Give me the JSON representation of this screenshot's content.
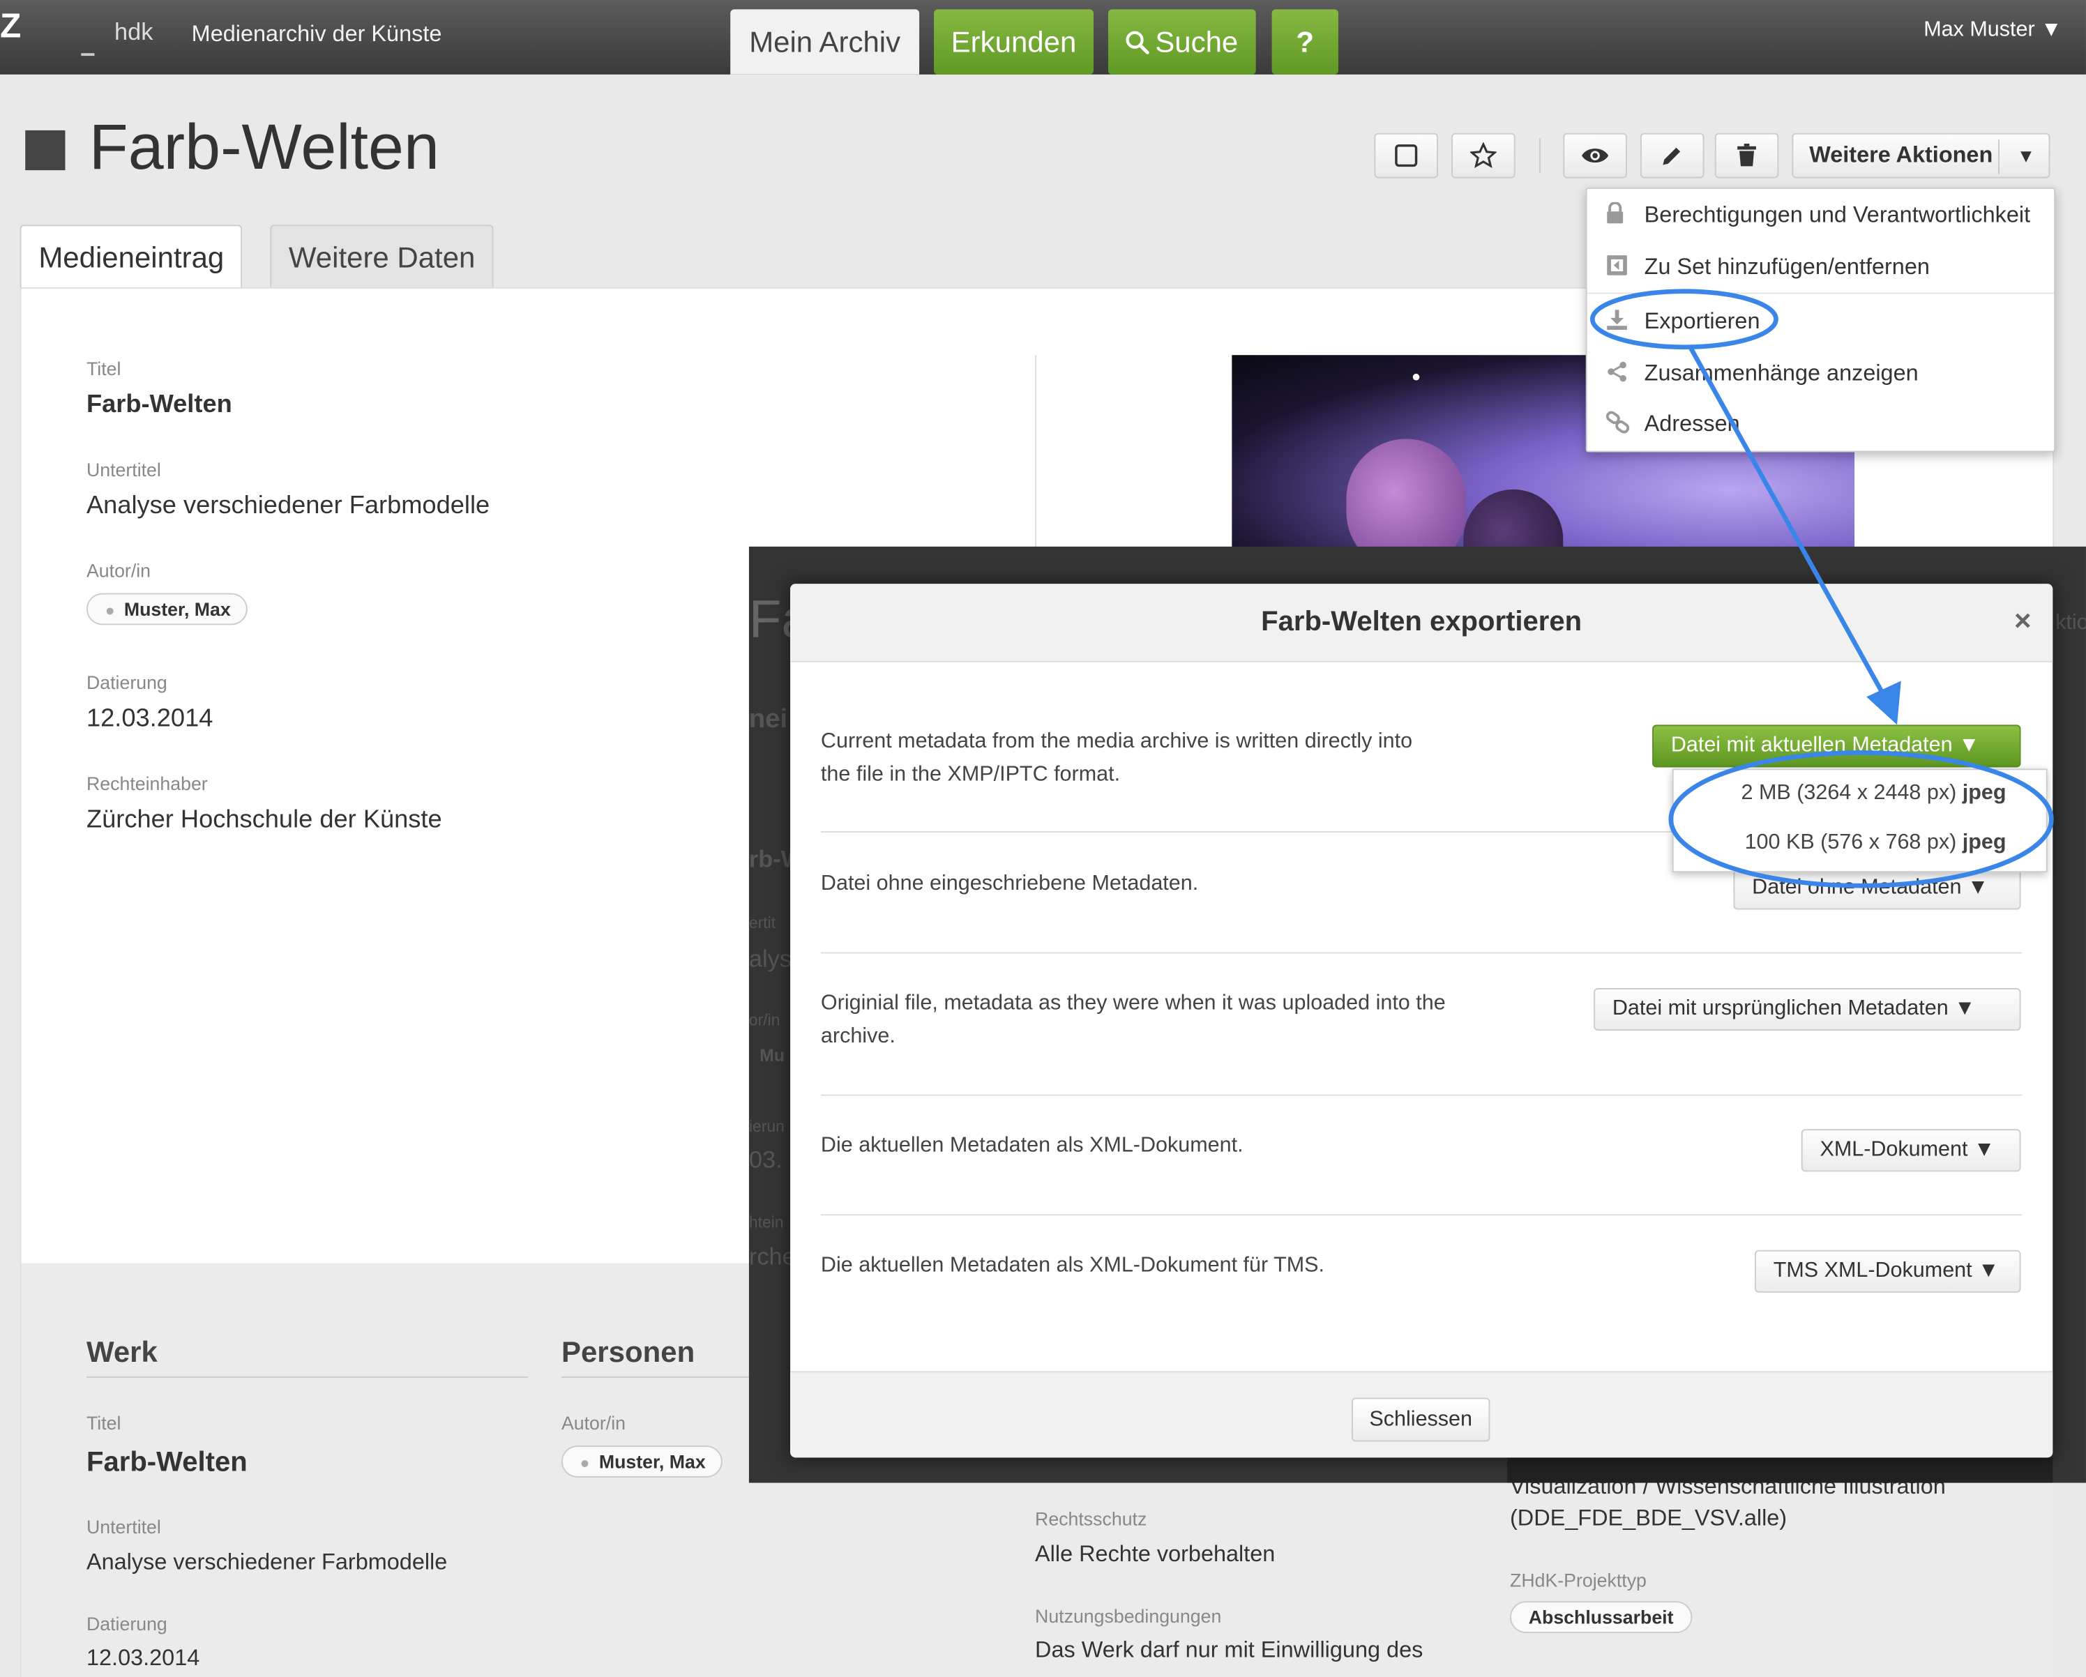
{
  "topbar": {
    "logo_letter": "Z",
    "logo_text": "hdk",
    "app_title": "Medienarchiv der Künste",
    "nav": {
      "mein_archiv": "Mein Archiv",
      "erkunden": "Erkunden",
      "suche": "Suche",
      "help": "?"
    },
    "user": "Max Muster ▼"
  },
  "page": {
    "title": "Farb-Welten",
    "more_actions": "Weitere Aktionen",
    "tabs": {
      "medieneintrag": "Medieneintrag",
      "weitere_daten": "Weitere Daten"
    }
  },
  "fields": {
    "titel_label": "Titel",
    "titel_value": "Farb-Welten",
    "untertitel_label": "Untertitel",
    "untertitel_value": "Analyse verschiedener Farbmodelle",
    "autor_label": "Autor/in",
    "autor_value": "Muster, Max",
    "datierung_label": "Datierung",
    "datierung_value": "12.03.2014",
    "rechte_label": "Rechteinhaber",
    "rechte_value": "Zürcher Hochschule der Künste"
  },
  "lower": {
    "werk": "Werk",
    "personen": "Personen",
    "titel_label": "Titel",
    "titel_value": "Farb-Welten",
    "untertitel_label": "Untertitel",
    "untertitel_value": "Analyse verschiedener Farbmodelle",
    "datierung_label": "Datierung",
    "datierung_value": "12.03.2014",
    "autor_label": "Autor/in",
    "autor_value": "Muster, Max",
    "rechtsschutz_label": "Rechtsschutz",
    "rechtsschutz_value": "Alle Rechte vorbehalten",
    "nutzung_label": "Nutzungsbedingungen",
    "nutzung_value": "Das Werk darf nur mit Einwilligung des",
    "vis_value1": "Visualization / Wissenschaftliche Illustration",
    "vis_value2": "(DDE_FDE_BDE_VSV.alle)",
    "projekttyp_label": "ZHdK-Projekttyp",
    "projekttyp_value": "Abschlussarbeit"
  },
  "menu": {
    "items": [
      "Berechtigungen und Verantwortlichkeit",
      "Zu Set hinzufügen/entfernen",
      "Exportieren",
      "Zusammenhänge anzeigen",
      "Adressen"
    ]
  },
  "modal": {
    "title": "Farb-Welten exportieren",
    "close_x": "×",
    "rows": [
      {
        "desc": "Current metadata from the media archive is written directly into the file in the XMP/IPTC format.",
        "button": "Datei mit aktuellen Metadaten ▼"
      },
      {
        "desc": "Datei ohne eingeschriebene Metadaten.",
        "button": "Datei ohne Metadaten ▼"
      },
      {
        "desc": "Originial file, metadata as they were when it was uploaded into the archive.",
        "button": "Datei mit ursprünglichen Metadaten ▼"
      },
      {
        "desc": "Die aktuellen Metadaten als XML-Dokument.",
        "button": "XML-Dokument ▼"
      },
      {
        "desc": "Die aktuellen Metadaten als XML-Dokument für TMS.",
        "button": "TMS XML-Dokument ▼"
      }
    ],
    "dropdown": [
      {
        "size": "2 MB (3264 x 2448 px)",
        "format": "jpeg"
      },
      {
        "size": "100 KB (576 x 768 px)",
        "format": "jpeg"
      }
    ],
    "close_button": "Schliessen"
  },
  "ghost": {
    "a": "Fa",
    "b": "nei",
    "c": "rb-W",
    "d": "ertit",
    "e": "alys",
    "f": "or/in",
    "g": "Mu",
    "h": "ierun",
    "i": "03.",
    "j": "htein",
    "k": "rche",
    "l": "ktio"
  },
  "colors": {
    "accent_green": "#6aa62d",
    "annotation_blue": "#3a86e8",
    "topbar": "#4a4a4a"
  },
  "icons": {
    "select": "square-icon",
    "favorite": "star-icon",
    "view": "eye-icon",
    "edit": "pencil-icon",
    "delete": "trash-icon",
    "lock": "lock-icon",
    "set": "set-icon",
    "export": "download-icon",
    "share": "share-icon",
    "link": "link-icon",
    "search": "search-icon",
    "person": "person-icon"
  }
}
